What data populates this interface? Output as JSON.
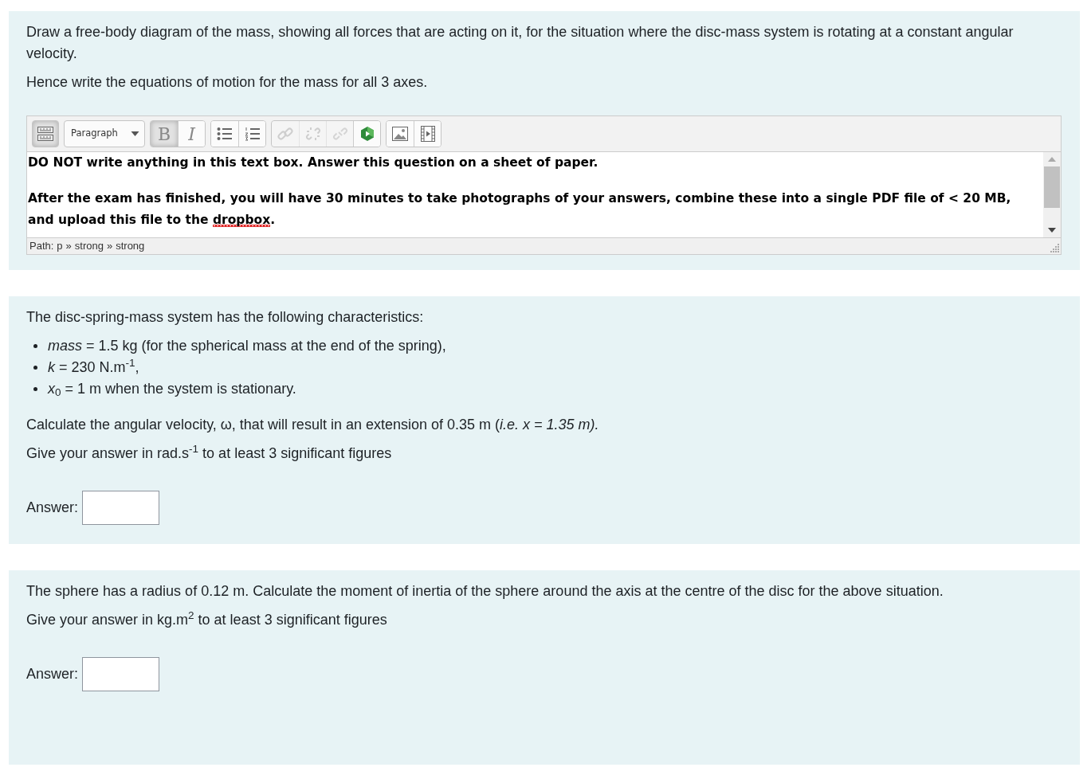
{
  "questions": [
    {
      "kind": "essay",
      "text": [
        "Draw a free-body diagram of the mass, showing all forces that are acting on it, for the situation where the disc-mass system is rotating at a constant angular velocity.",
        "Hence write the equations of motion for the mass for all 3 axes."
      ],
      "editor": {
        "toolbar": [
          [
            {
              "kind": "toggle",
              "pressed": true,
              "disabled": false
            }
          ],
          [
            {
              "kind": "format-select",
              "value": "Paragraph",
              "pressed": false,
              "disabled": false
            }
          ],
          [
            {
              "kind": "bold",
              "label": "B",
              "pressed": true,
              "disabled": false
            },
            {
              "kind": "italic",
              "label": "I",
              "pressed": false,
              "disabled": false
            }
          ],
          [
            {
              "kind": "bullet-list",
              "pressed": false,
              "disabled": false
            },
            {
              "kind": "numbered-list",
              "pressed": false,
              "disabled": false
            }
          ],
          [
            {
              "kind": "link",
              "pressed": false,
              "disabled": true
            },
            {
              "kind": "unlink",
              "pressed": false,
              "disabled": true
            },
            {
              "kind": "anchor",
              "pressed": false,
              "disabled": true
            },
            {
              "kind": "media-plugin",
              "pressed": false,
              "disabled": false
            }
          ],
          [
            {
              "kind": "image",
              "pressed": false,
              "disabled": false
            },
            {
              "kind": "video",
              "pressed": false,
              "disabled": false
            }
          ]
        ],
        "content": [
          [
            {
              "text": "DO NOT write anything in this text box. Answer this question on a sheet of paper.",
              "misspelled": false
            }
          ],
          [
            {
              "text": "After the exam has finished, you will have 30 minutes to take photographs of your answers, combine these into a single PDF file of < 20 MB, and upload this file to the ",
              "misspelled": false
            },
            {
              "text": "dropbox",
              "misspelled": true
            },
            {
              "text": ".",
              "misspelled": false
            }
          ]
        ],
        "path": {
          "label": "Path:",
          "separator": "»",
          "items": [
            "p",
            "strong",
            "strong"
          ]
        }
      }
    },
    {
      "kind": "numeric",
      "text": [
        "The disc-spring-mass system has the following characteristics:"
      ],
      "bullets": [
        "*mass* = 1.5 kg (for the spherical mass at the end of the spring),",
        "*k* = 230 N.m$^{-1}$,",
        "*x*$_{0}$ = 1 m when the system is stationary."
      ],
      "text_after": [
        "Calculate the angular velocity, ω, that will result in an extension of 0.35 m (*i.e. x = 1.35 m).*",
        "Give your answer in rad.s$^{-1}$ to at least 3 significant figures"
      ],
      "answer_label": "Answer:"
    },
    {
      "kind": "numeric",
      "text": [
        "The sphere has a radius of 0.12 m. Calculate the moment of inertia of the sphere around the axis at the centre of the disc for the above situation.",
        "Give your answer in kg.m$^{2}$ to at least 3 significant figures"
      ],
      "answer_label": "Answer:"
    }
  ]
}
